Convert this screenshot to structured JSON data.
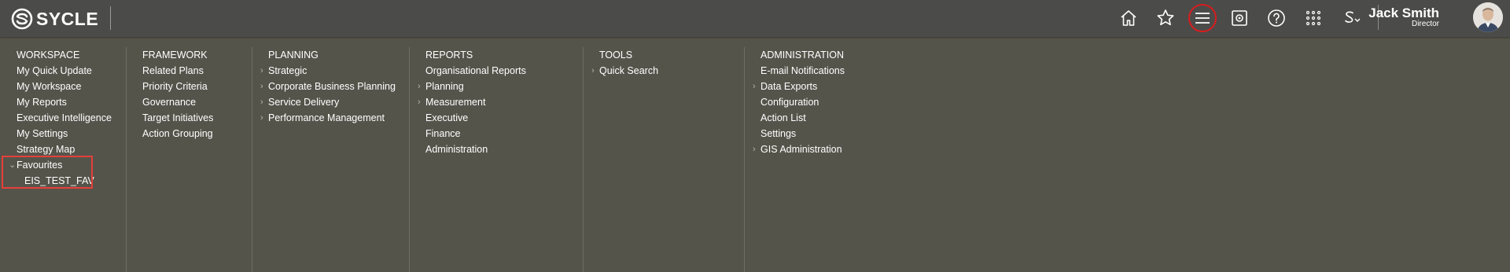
{
  "brand": {
    "name": "SYCLE"
  },
  "user": {
    "name": "Jack Smith",
    "role": "Director"
  },
  "top_icons": [
    "home-icon",
    "star-icon",
    "hamburger-menu-icon",
    "screen-record-icon",
    "help-icon",
    "apps-grid-icon",
    "s-dropdown-icon"
  ],
  "menu": {
    "workspace": {
      "title": "WORKSPACE",
      "items": [
        "My Quick Update",
        "My Workspace",
        "My Reports",
        "Executive Intelligence",
        "My Settings",
        "Strategy Map",
        "Favourites"
      ],
      "favourites": [
        "EIS_TEST_FAV"
      ]
    },
    "framework": {
      "title": "FRAMEWORK",
      "items": [
        "Related Plans",
        "Priority Criteria",
        "Governance",
        "Target Initiatives",
        "Action Grouping"
      ]
    },
    "planning": {
      "title": "PLANNING",
      "items": [
        "Strategic",
        "Corporate Business Planning",
        "Service Delivery",
        "Performance Management"
      ]
    },
    "reports": {
      "title": "REPORTS",
      "items": [
        "Organisational Reports",
        "Planning",
        "Measurement",
        "Executive",
        "Finance",
        "Administration"
      ]
    },
    "tools": {
      "title": "TOOLS",
      "items": [
        "Quick Search"
      ]
    },
    "administration": {
      "title": "ADMINISTRATION",
      "items": [
        "E-mail Notifications",
        "Data Exports",
        "Configuration",
        "Action List",
        "Settings",
        "GIS Administration"
      ]
    }
  },
  "colors": {
    "topbar": "#4b4b4a",
    "menu_background": "#55544b",
    "highlight_red": "#e5403a",
    "ring_red": "#d91d1d"
  }
}
